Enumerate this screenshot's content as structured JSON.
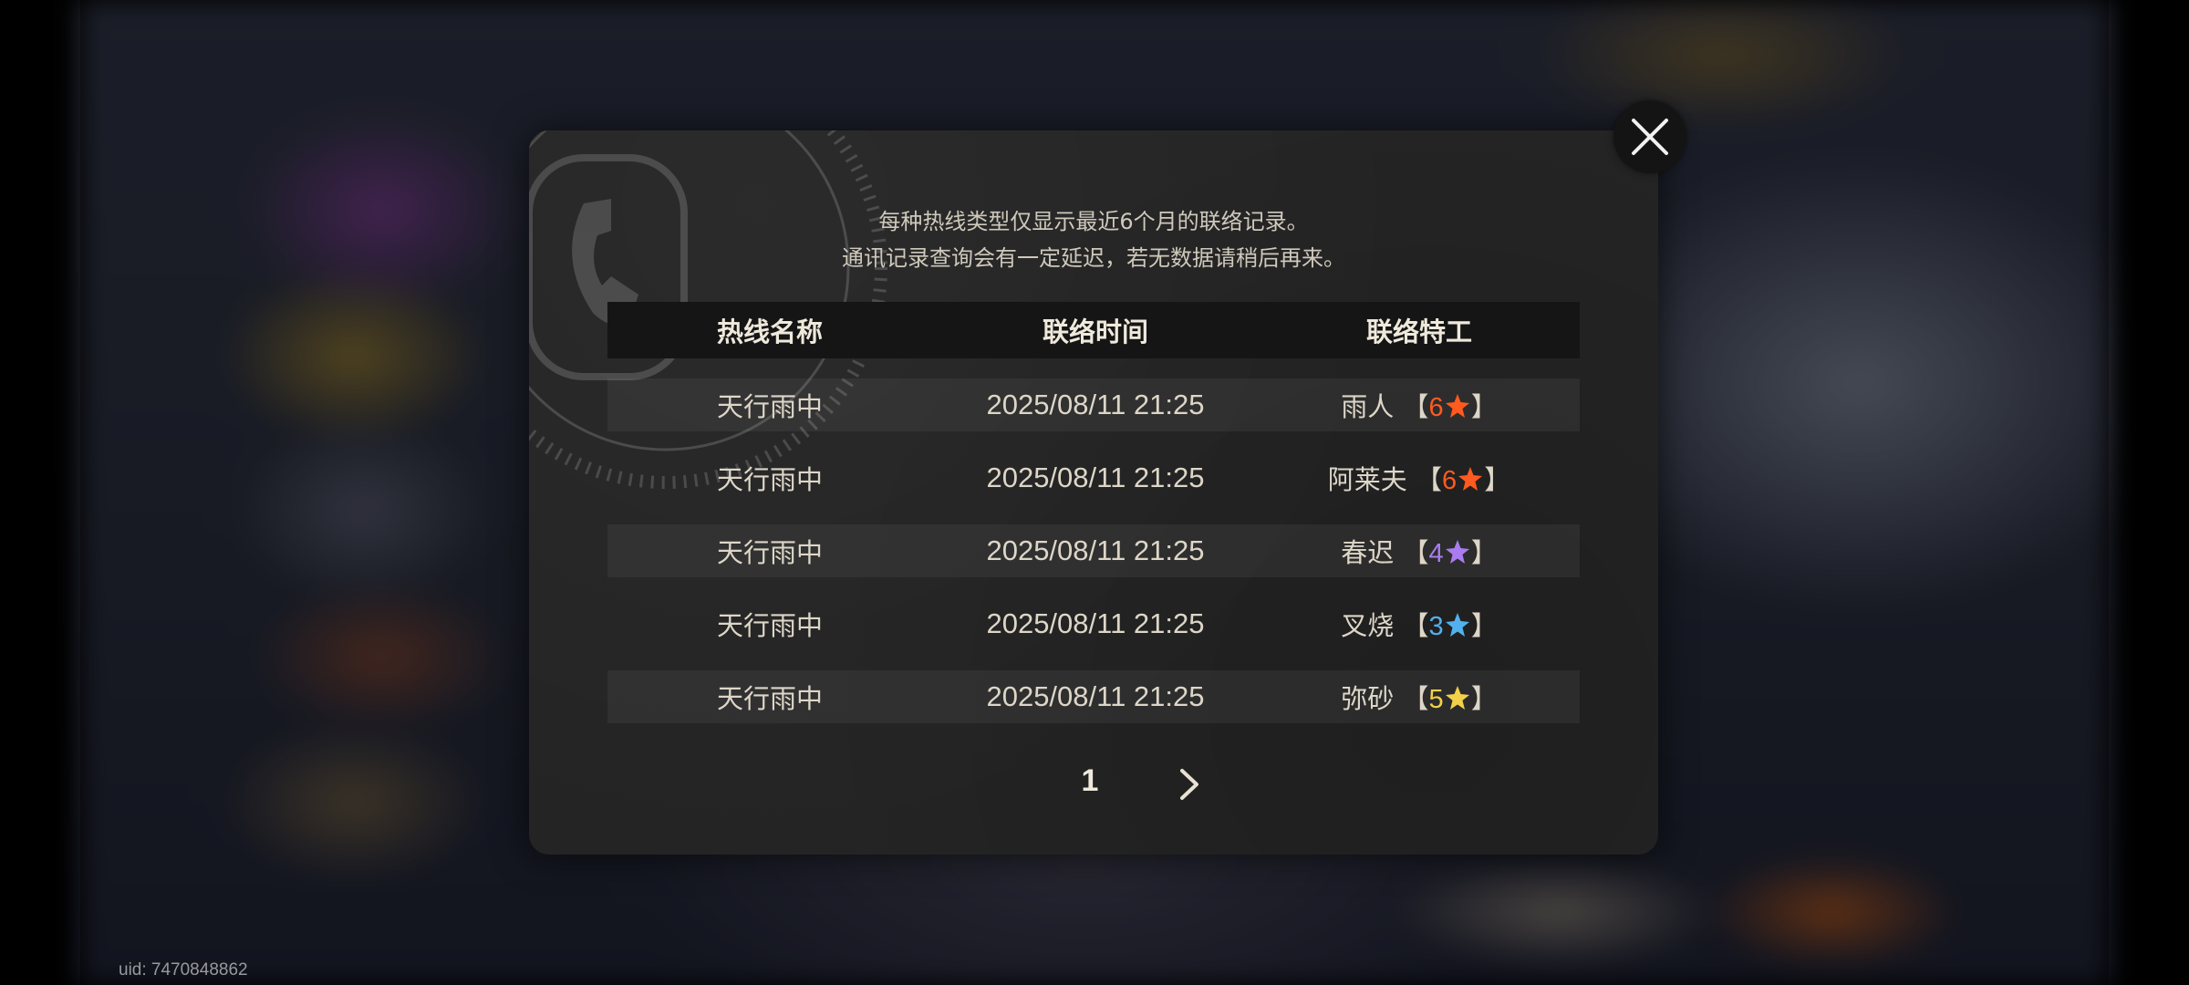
{
  "dialog": {
    "notice_line1": "每种热线类型仅显示最近6个月的联络记录。",
    "notice_line2": "通讯记录查询会有一定延迟，若无数据请稍后再来。",
    "close_icon": "close-icon"
  },
  "table": {
    "headers": [
      "热线名称",
      "联络时间",
      "联络特工"
    ],
    "rows": [
      {
        "hotline": "天行雨中",
        "time": "2025/08/11 21:25",
        "agent": "雨人",
        "rarity": "6",
        "star_color": "#ff5a1f"
      },
      {
        "hotline": "天行雨中",
        "time": "2025/08/11 21:25",
        "agent": "阿莱夫",
        "rarity": "6",
        "star_color": "#ff5a1f"
      },
      {
        "hotline": "天行雨中",
        "time": "2025/08/11 21:25",
        "agent": "春迟",
        "rarity": "4",
        "star_color": "#a97cf0"
      },
      {
        "hotline": "天行雨中",
        "time": "2025/08/11 21:25",
        "agent": "叉烧",
        "rarity": "3",
        "star_color": "#52b0ee"
      },
      {
        "hotline": "天行雨中",
        "time": "2025/08/11 21:25",
        "agent": "弥砂",
        "rarity": "5",
        "star_color": "#f3d04a"
      }
    ],
    "bracket_open": "【",
    "bracket_close": "】"
  },
  "pagination": {
    "current_page": "1",
    "next_icon": "chevron-right-icon"
  },
  "footer": {
    "uid": "uid: 7470848862"
  }
}
